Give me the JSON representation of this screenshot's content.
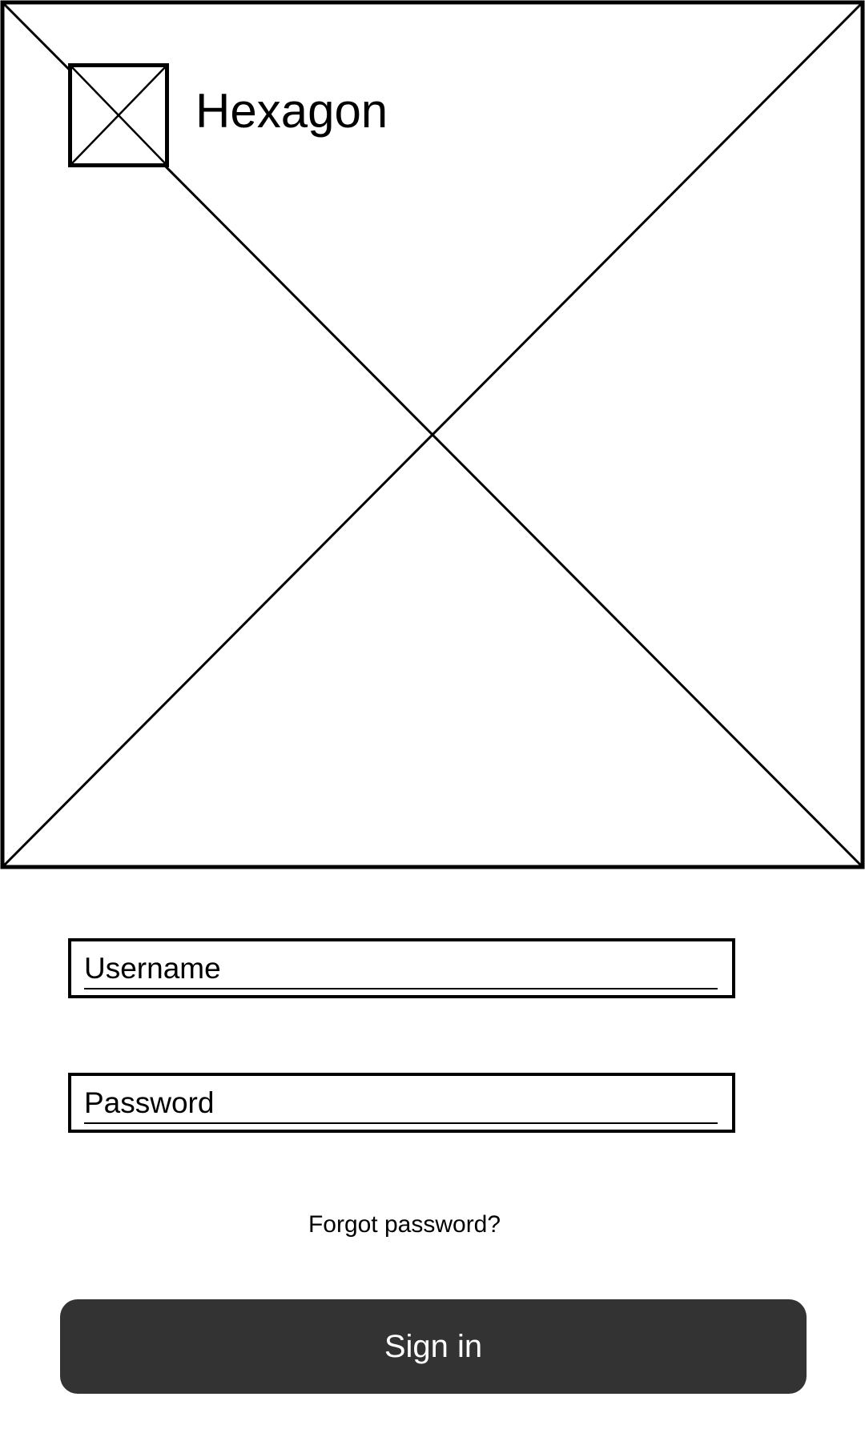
{
  "app": {
    "name": "Hexagon"
  },
  "hero": {
    "icon": "image-placeholder-icon"
  },
  "logo": {
    "icon": "image-placeholder-icon"
  },
  "login": {
    "username_placeholder": "Username",
    "password_placeholder": "Password",
    "forgot_label": "Forgot password?",
    "signin_label": "Sign in"
  },
  "colors": {
    "button_bg": "#333333",
    "button_text": "#ffffff",
    "stroke": "#000000"
  }
}
